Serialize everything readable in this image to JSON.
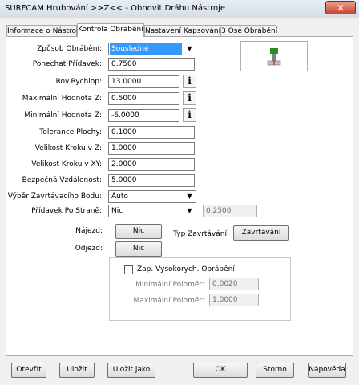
{
  "window": {
    "title": "SURFCAM Hrubování >>Z<< - Obnovit Dráhu Nástroje",
    "close_glyph": "✕"
  },
  "tabs": [
    {
      "label": "Informace o Nástroji"
    },
    {
      "label": "Kontrola Obrábění"
    },
    {
      "label": "Nastavení Kapsování"
    },
    {
      "label": "3 Osé Obrábění"
    }
  ],
  "active_tab": "Kontrola Obrábění",
  "form": {
    "zpusob": {
      "label": "Způsob Obrábění:",
      "value": "Sousledné"
    },
    "ponechat": {
      "label": "Ponechat Přídavek:",
      "value": "0.7500"
    },
    "rychlop": {
      "label": "Rov.Rychlop:",
      "value": "13.0000"
    },
    "max_z": {
      "label": "Maximální Hodnota Z:",
      "value": "0.5000"
    },
    "min_z": {
      "label": "Minimální Hodnota Z:",
      "value": "-6.0000"
    },
    "tolerance": {
      "label": "Tolerance Plochy:",
      "value": "0.1000"
    },
    "krok_z": {
      "label": "Velikost Kroku v Z:",
      "value": "1.0000"
    },
    "krok_xy": {
      "label": "Velikost Kroku v XY:",
      "value": "2.0000"
    },
    "bezpecna": {
      "label": "Bezpečná Vzdálenost:",
      "value": "5.0000"
    },
    "vyber": {
      "label": "Výběr Zavrtávacího Bodu:",
      "value": "Auto"
    },
    "pridavek_strane": {
      "label": "Přídavek Po Straně:",
      "value": "Nic",
      "extra_value": "0.2500"
    },
    "info_glyph": "i"
  },
  "najezd": {
    "label": "Nájezd:",
    "button": "Nic"
  },
  "typ_zavrtavani": {
    "label": "Typ Zavrtávání:",
    "button": "Zavrtávání"
  },
  "odjezd": {
    "label": "Odjezd:",
    "button": "Nic"
  },
  "high_speed": {
    "checkbox_label": "Zap. Vysokorych. Obrábění",
    "checked": false,
    "min_polomer": {
      "label": "Minimální Poloměr:",
      "value": "0.0020"
    },
    "max_polomer": {
      "label": "Maximální Poloměr:",
      "value": "1.0000"
    }
  },
  "footer": {
    "otevrit": "Otevřít",
    "ulozit": "Uložit",
    "ulozit_jako": "Uložit jako",
    "ok": "OK",
    "storno": "Storno",
    "napoveda": "Nápověda"
  },
  "colors": {
    "selection": "#3399ff",
    "info_dot": "#d4a000"
  }
}
